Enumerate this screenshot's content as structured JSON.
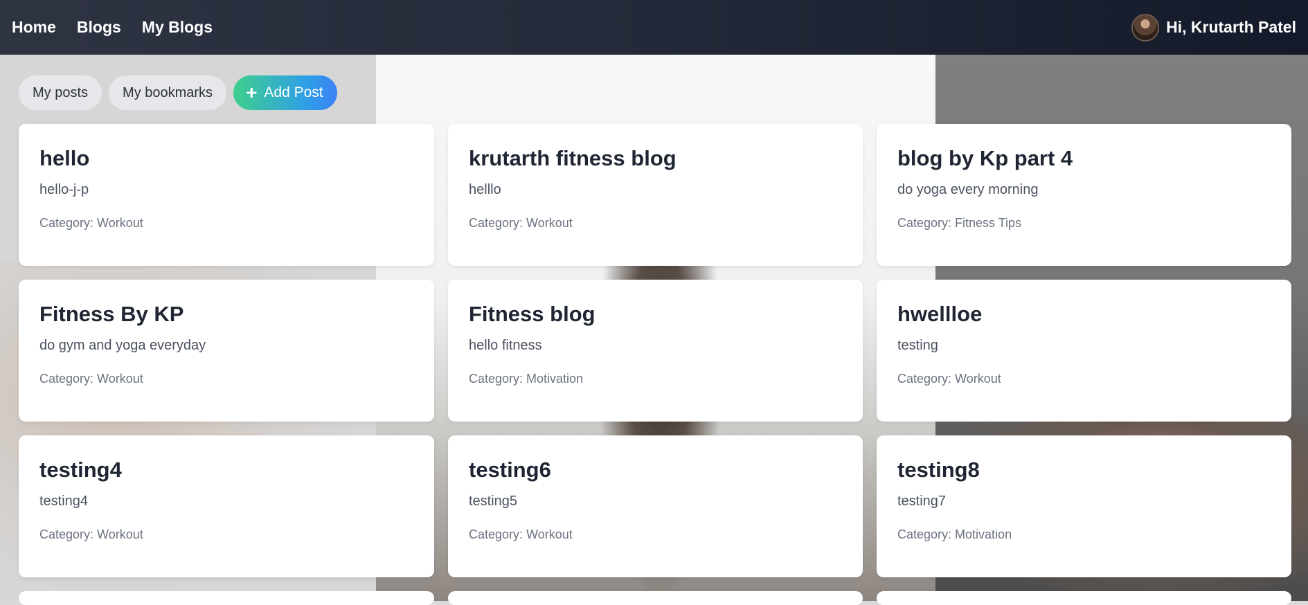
{
  "nav": {
    "links": [
      "Home",
      "Blogs",
      "My Blogs"
    ],
    "greeting": "Hi, Krutarth Patel"
  },
  "toolbar": {
    "my_posts": "My posts",
    "my_bookmarks": "My bookmarks",
    "add_post": "Add Post",
    "add_icon": "+"
  },
  "posts": [
    {
      "title": "hello",
      "description": "hello-j-p",
      "category": "Category: Workout"
    },
    {
      "title": "krutarth fitness blog",
      "description": "helllo",
      "category": "Category: Workout"
    },
    {
      "title": "blog by Kp part 4",
      "description": "do yoga every morning",
      "category": "Category: Fitness Tips"
    },
    {
      "title": "Fitness By KP",
      "description": "do gym and yoga everyday",
      "category": "Category: Workout"
    },
    {
      "title": "Fitness blog",
      "description": "hello fitness",
      "category": "Category: Motivation"
    },
    {
      "title": "hwellloe",
      "description": "testing",
      "category": "Category: Workout"
    },
    {
      "title": "testing4",
      "description": "testing4",
      "category": "Category: Workout"
    },
    {
      "title": "testing6",
      "description": "testing5",
      "category": "Category: Workout"
    },
    {
      "title": "testing8",
      "description": "testing7",
      "category": "Category: Motivation"
    }
  ]
}
